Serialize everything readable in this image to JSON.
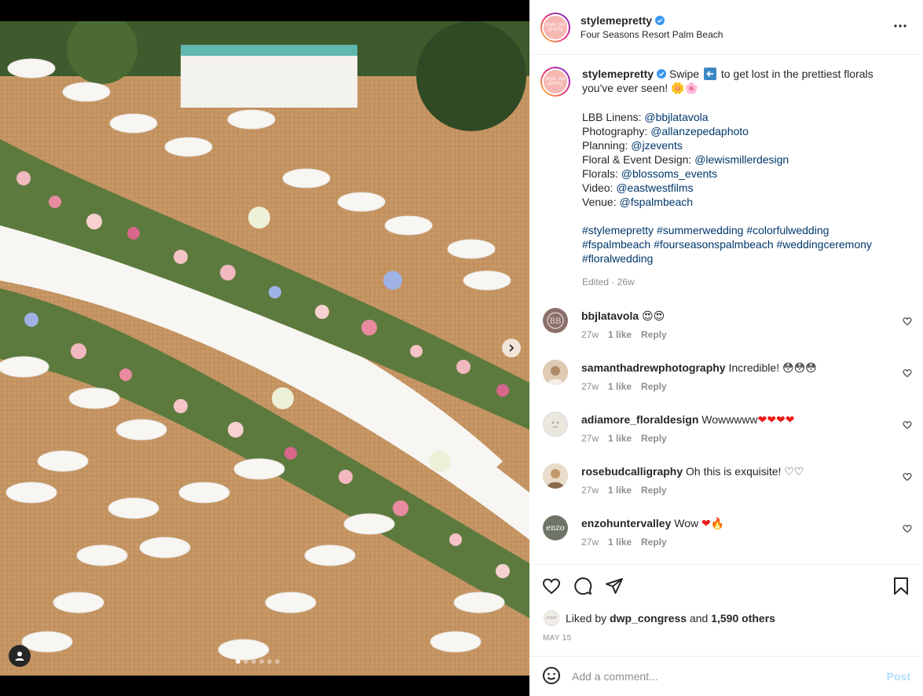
{
  "post": {
    "username": "stylemepretty",
    "location": "Four Seasons Resort Palm Beach",
    "avatar_logo_text": "style me pretty"
  },
  "caption": {
    "username": "stylemepretty",
    "text_before_emoji": "Swipe",
    "swipe_icon": "arrow-left-icon",
    "text_after_emoji": "to get lost in the prettiest florals you've ever seen!",
    "flowers": "🌼🌸",
    "credits": [
      {
        "label": "LBB Linens:",
        "handle": "@bbjlatavola"
      },
      {
        "label": "Photography:",
        "handle": "@allanzepedaphoto"
      },
      {
        "label": "Planning:",
        "handle": "@jzevents"
      },
      {
        "label": "Floral & Event Design:",
        "handle": "@lewismillerdesign"
      },
      {
        "label": "Florals:",
        "handle": "@blossoms_events"
      },
      {
        "label": "Video:",
        "handle": "@eastwestfilms"
      },
      {
        "label": "Venue:",
        "handle": "@fspalmbeach"
      }
    ],
    "hashtags": [
      "#stylemepretty",
      "#summerwedding",
      "#colorfulwedding",
      "#fspalmbeach",
      "#fourseasonspalmbeach",
      "#weddingceremony",
      "#floralwedding"
    ],
    "edited": "Edited · 26w"
  },
  "comments": [
    {
      "user": "bbjlatavola",
      "text": "",
      "emoji": "😍😍",
      "age": "27w",
      "likes": "1 like",
      "reply": "Reply",
      "avatar_color": "#8a6f6a"
    },
    {
      "user": "samanthadrewphotography",
      "text": "Incredible!",
      "emoji": "😳😳😳",
      "age": "27w",
      "likes": "1 like",
      "reply": "Reply",
      "avatar_color": "#c9a98a"
    },
    {
      "user": "adiamore_floraldesign",
      "text": "Wowwwww",
      "emoji": "❤❤❤❤",
      "age": "27w",
      "likes": "1 like",
      "reply": "Reply",
      "avatar_color": "#e9e7de"
    },
    {
      "user": "rosebudcalligraphy",
      "text": "Oh this is exquisite!",
      "emoji": "♡♡",
      "age": "27w",
      "likes": "1 like",
      "reply": "Reply",
      "avatar_color": "#b89a7c"
    },
    {
      "user": "enzohuntervalley",
      "text": "Wow",
      "emoji": "❤🔥",
      "age": "27w",
      "likes": "1 like",
      "reply": "Reply",
      "avatar_color": "#6f7566",
      "avatar_text": "enzo"
    }
  ],
  "actions": {
    "liked_by_prefix": "Liked by",
    "liked_by_user": "dwp_congress",
    "liked_by_and": "and",
    "liked_by_count": "1,590 others",
    "date": "MAY 15",
    "mini_avatar_text": "DWP"
  },
  "add_comment": {
    "placeholder": "Add a comment...",
    "post_label": "Post"
  },
  "carousel": {
    "slides": 6,
    "active_index": 0
  },
  "colors": {
    "verified": "#3897f0",
    "link": "#00376b",
    "muted": "#8e8e8e",
    "post_disabled": "#b2dffc"
  }
}
